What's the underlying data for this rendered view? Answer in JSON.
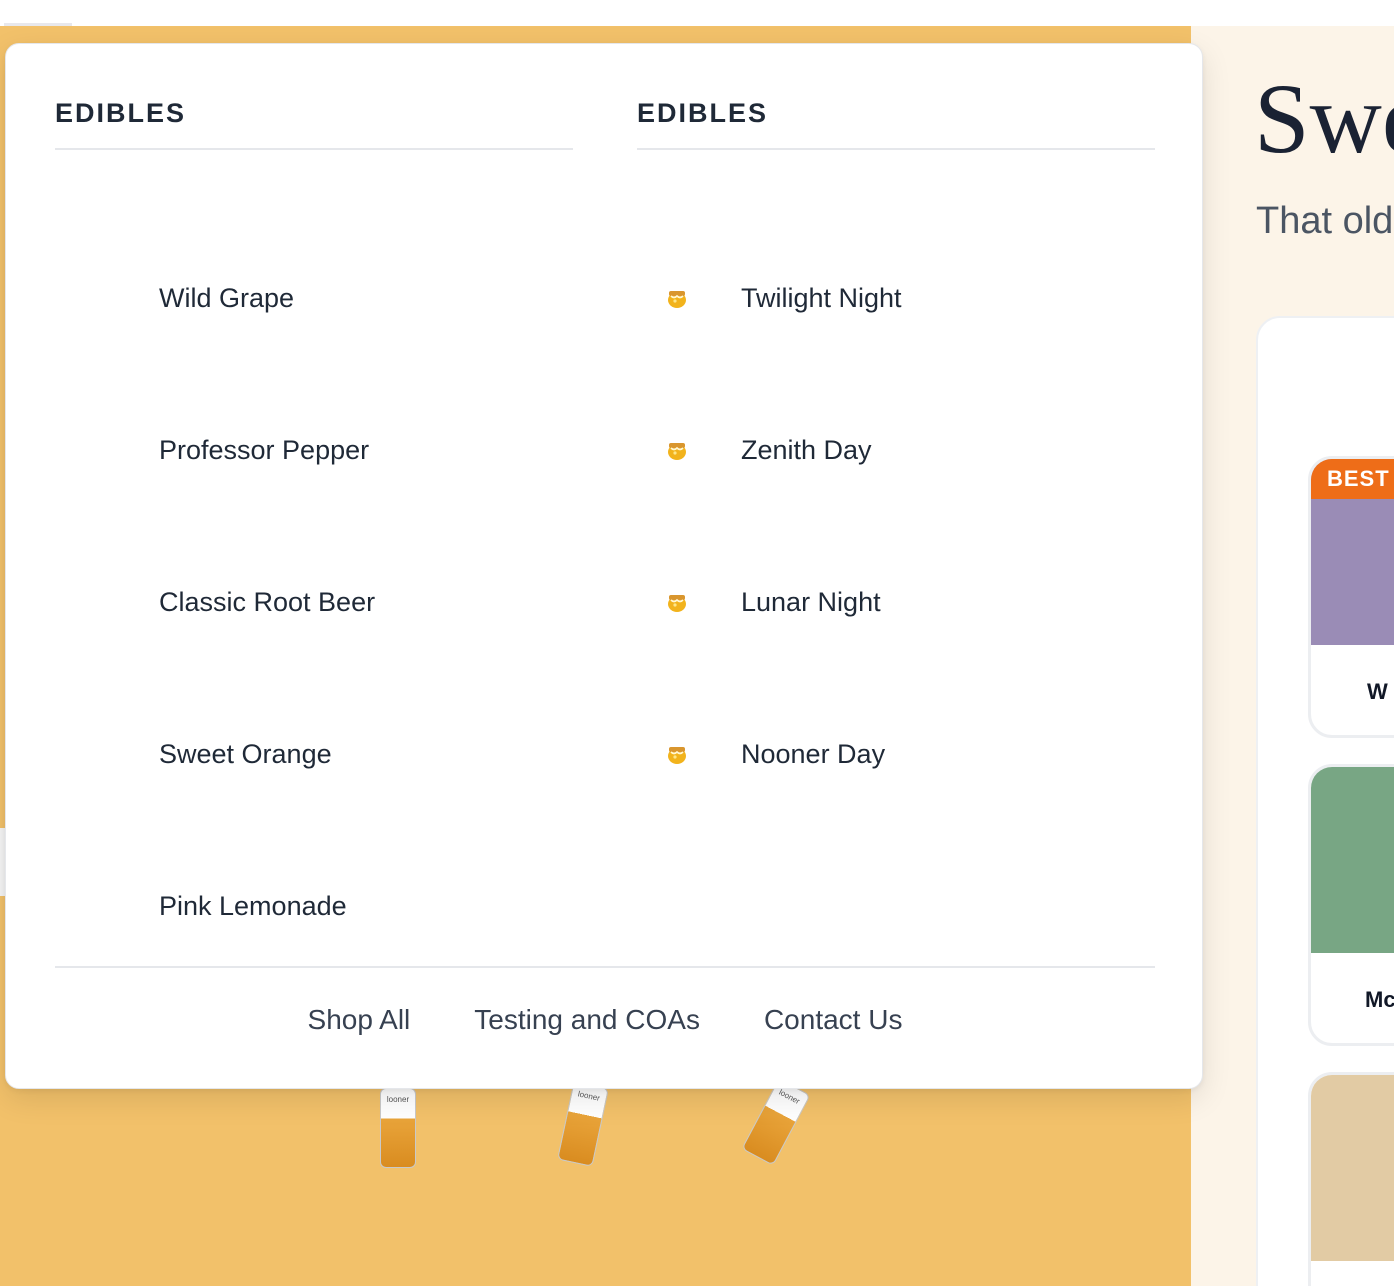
{
  "menu": {
    "left_column": {
      "heading": "EDIBLES",
      "items": [
        {
          "label": "Wild Grape",
          "icon": null
        },
        {
          "label": "Professor Pepper",
          "icon": null
        },
        {
          "label": "Classic Root Beer",
          "icon": null
        },
        {
          "label": "Sweet Orange",
          "icon": null
        },
        {
          "label": "Pink Lemonade",
          "icon": null
        }
      ]
    },
    "right_column": {
      "heading": "EDIBLES",
      "items": [
        {
          "label": "Twilight Night",
          "icon": "honey-pot-icon"
        },
        {
          "label": "Zenith Day",
          "icon": "honey-pot-icon"
        },
        {
          "label": "Lunar Night",
          "icon": "honey-pot-icon"
        },
        {
          "label": "Nooner Day",
          "icon": "honey-pot-icon"
        }
      ]
    },
    "footer_links": [
      "Shop All",
      "Testing and COAs",
      "Contact Us"
    ]
  },
  "hero": {
    "can_labels": [
      "looner",
      "looner",
      "looner"
    ]
  },
  "right_panel": {
    "title": "Swe",
    "subtitle": "That old",
    "badge": "BEST",
    "cards": [
      {
        "name": "W",
        "color": "#9a8cb6"
      },
      {
        "name": "Mc",
        "color": "#78a684"
      },
      {
        "name": "",
        "color": "#e2cba4"
      }
    ]
  },
  "colors": {
    "hero_background": "#f2c16a",
    "badge": "#ee6d18",
    "page_background": "#fcf4e8"
  }
}
